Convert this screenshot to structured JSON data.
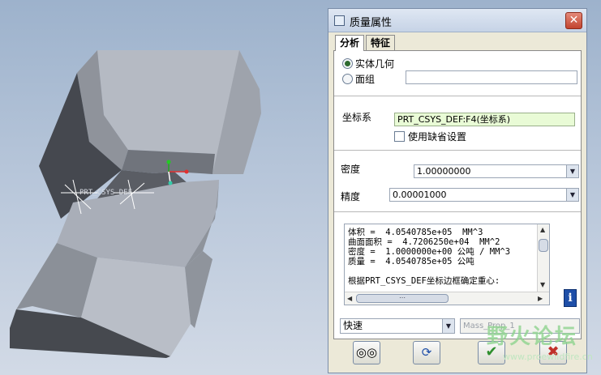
{
  "window": {
    "title": "质量属性"
  },
  "tabs": [
    {
      "label": "分析"
    },
    {
      "label": "特征"
    }
  ],
  "geometry": {
    "solid_label": "实体几何",
    "quilt_label": "面组",
    "solid_selected": true,
    "quilt_value": ""
  },
  "coordinate_system": {
    "label": "坐标系",
    "value": "PRT_CSYS_DEF:F4(坐标系)",
    "use_default_label": "使用缺省设置",
    "use_default_checked": false
  },
  "density": {
    "label": "密度",
    "value": "1.00000000"
  },
  "accuracy": {
    "label": "精度",
    "value": "0.00001000"
  },
  "results": [
    "体积 =  4.0540785e+05  MM^3",
    "曲面面积 =  4.7206250e+04  MM^2",
    "密度 =  1.0000000e+00 公吨 / MM^3",
    "质量 =  4.0540785e+05 公吨",
    "",
    "根据PRT_CSYS_DEF坐标边框确定重心:"
  ],
  "mode": {
    "value": "快速"
  },
  "analysis_name": {
    "value": "Mass_Prop_1"
  },
  "buttons": {
    "glasses_icon": "glasses-icon",
    "repeat_icon": "repeat-icon",
    "ok_icon": "checkmark-icon",
    "cancel_icon": "cancel-icon"
  },
  "viewport": {
    "csys_label": "PRT_CSYS_DEF"
  },
  "watermark": {
    "title": "野火论坛",
    "url": "www.proewildfire.cn"
  },
  "colors": {
    "part": "#a4a9b3",
    "part_dark": "#4a4d55",
    "accent_ok": "#2f8f2f",
    "accent_cancel": "#c0302a"
  }
}
